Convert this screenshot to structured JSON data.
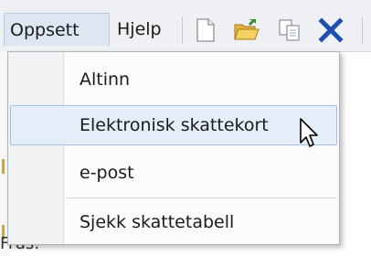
{
  "menubar": {
    "items": [
      {
        "label": "Oppsett",
        "active": true
      },
      {
        "label": "Hjelp",
        "active": false
      }
    ]
  },
  "toolbar": {
    "icons": [
      "new-document-icon",
      "open-folder-icon",
      "copy-icon",
      "delete-icon"
    ]
  },
  "dropdown": {
    "items": [
      {
        "label": "Altinn",
        "highlighted": false
      },
      {
        "label": "Elektronisk skattekort",
        "highlighted": true
      },
      {
        "label": "e-post",
        "highlighted": false
      },
      {
        "label": "Sjekk skattetabell",
        "highlighted": false
      }
    ]
  },
  "background": {
    "partial_text": "Frus:"
  },
  "colors": {
    "highlight_bg": "#e4eefa",
    "highlight_border": "#9fc0e8",
    "delete_x": "#1f4fb0"
  }
}
